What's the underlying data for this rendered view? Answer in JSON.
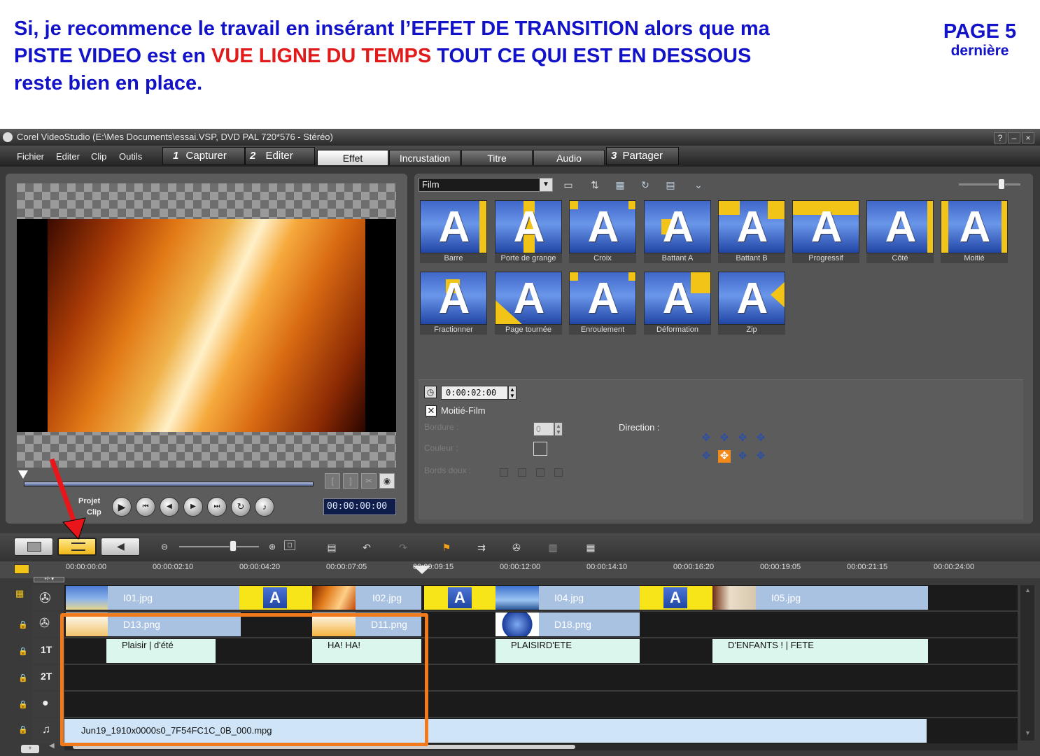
{
  "header": {
    "line1": "Si, je recommence le travail en insérant l’EFFET DE TRANSITION  alors que ma",
    "line2_part1": "PISTE VIDEO est en ",
    "line2_red": "VUE LIGNE DU TEMPS",
    "line2_part3": " TOUT CE QUI EST EN DESSOUS",
    "line3": "reste bien en place.",
    "page_label": "PAGE 5",
    "page_sub": "dernière"
  },
  "window": {
    "title": "Corel VideoStudio (E:\\Mes Documents\\essai.VSP, DVD PAL 720*576 - Stéréo)",
    "controls": [
      "?",
      "–",
      "×"
    ]
  },
  "menu": [
    "Fichier",
    "Editer",
    "Clip",
    "Outils"
  ],
  "steps": [
    {
      "num": "1",
      "label": "Capturer"
    },
    {
      "num": "2",
      "label": "Editer"
    },
    {
      "num": "3",
      "label": "Partager"
    }
  ],
  "subtabs": [
    "Effet",
    "Incrustation",
    "Titre",
    "Audio"
  ],
  "library": {
    "category": "Film",
    "thumbnails": [
      "Barre",
      "Porte de grange",
      "Croix",
      "Battant A",
      "Battant B",
      "Progressif",
      "Côté",
      "Moitié",
      "Fractionner",
      "Page tournée",
      "Enroulement",
      "Déformation",
      "Zip"
    ]
  },
  "options": {
    "duration": "0:00:02:00",
    "checkbox_label": "Moitié-Film",
    "border_label": "Bordure :",
    "border_value": "0",
    "color_label": "Couleur :",
    "soft_edges_label": "Bords doux :",
    "direction_label": "Direction :"
  },
  "player": {
    "projet_label": "Projet",
    "clip_label": "Clip",
    "timecode": "00:00:00:00"
  },
  "ruler": [
    "00:00:00:00",
    "00:00:02:10",
    "00:00:04:20",
    "00:00:07:05",
    "00:00:09:15",
    "00:00:12:00",
    "00:00:14:10",
    "00:00:16:20",
    "00:00:19:05",
    "00:00:21:15",
    "00:00:24:00"
  ],
  "tracks": {
    "video": [
      "I01.jpg",
      "I02.jpg",
      "I04.jpg",
      "I05.jpg"
    ],
    "overlay": [
      "D13.png",
      "D11.png",
      "D18.png"
    ],
    "title1": [
      "Plaisir | d'été",
      "HA!  HA!",
      "PLAISIRD'ETE",
      "D'ENFANTS ! | FETE"
    ],
    "music": [
      "Jun19_1910x0000s0_7F54FC1C_0B_000.mpg"
    ],
    "labels": [
      "1T",
      "2T"
    ]
  },
  "colors": {
    "header_blue": "#1212c8",
    "header_red": "#e21a1a",
    "annotation_orange": "#f07a1c",
    "arrow_red": "#e8161a"
  }
}
